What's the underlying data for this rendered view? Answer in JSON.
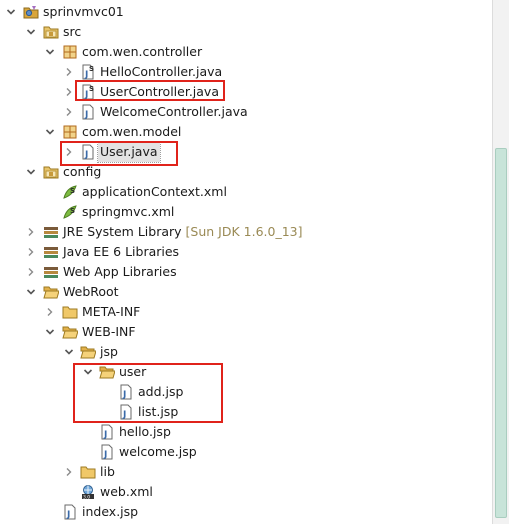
{
  "tree": {
    "project": {
      "label": "sprinvmvc01"
    },
    "src": {
      "label": "src"
    },
    "pkg_controller": {
      "label": "com.wen.controller"
    },
    "hello_controller": {
      "label": "HelloController.java"
    },
    "user_controller": {
      "label": "UserController.java"
    },
    "welcome_controller": {
      "label": "WelcomeController.java"
    },
    "pkg_model": {
      "label": "com.wen.model"
    },
    "user_java": {
      "label": "User.java"
    },
    "config": {
      "label": "config"
    },
    "app_context": {
      "label": "applicationContext.xml"
    },
    "springmvc_xml": {
      "label": "springmvc.xml"
    },
    "jre_lib": {
      "label": "JRE System Library",
      "decoration": "[Sun JDK 1.6.0_13]"
    },
    "javaee_lib": {
      "label": "Java EE 6 Libraries"
    },
    "webapp_lib": {
      "label": "Web App Libraries"
    },
    "webroot": {
      "label": "WebRoot"
    },
    "meta_inf": {
      "label": "META-INF"
    },
    "web_inf": {
      "label": "WEB-INF"
    },
    "jsp_folder": {
      "label": "jsp"
    },
    "user_folder": {
      "label": "user"
    },
    "add_jsp": {
      "label": "add.jsp"
    },
    "list_jsp": {
      "label": "list.jsp"
    },
    "hello_jsp": {
      "label": "hello.jsp"
    },
    "welcome_jsp": {
      "label": "welcome.jsp"
    },
    "lib_folder": {
      "label": "lib"
    },
    "web_xml": {
      "label": "web.xml"
    },
    "index_jsp": {
      "label": "index.jsp"
    }
  },
  "colors": {
    "highlight_border": "#e0231b",
    "selection_bg": "#e3e3e3",
    "scrollbar_thumb": "#c8e4d9"
  }
}
